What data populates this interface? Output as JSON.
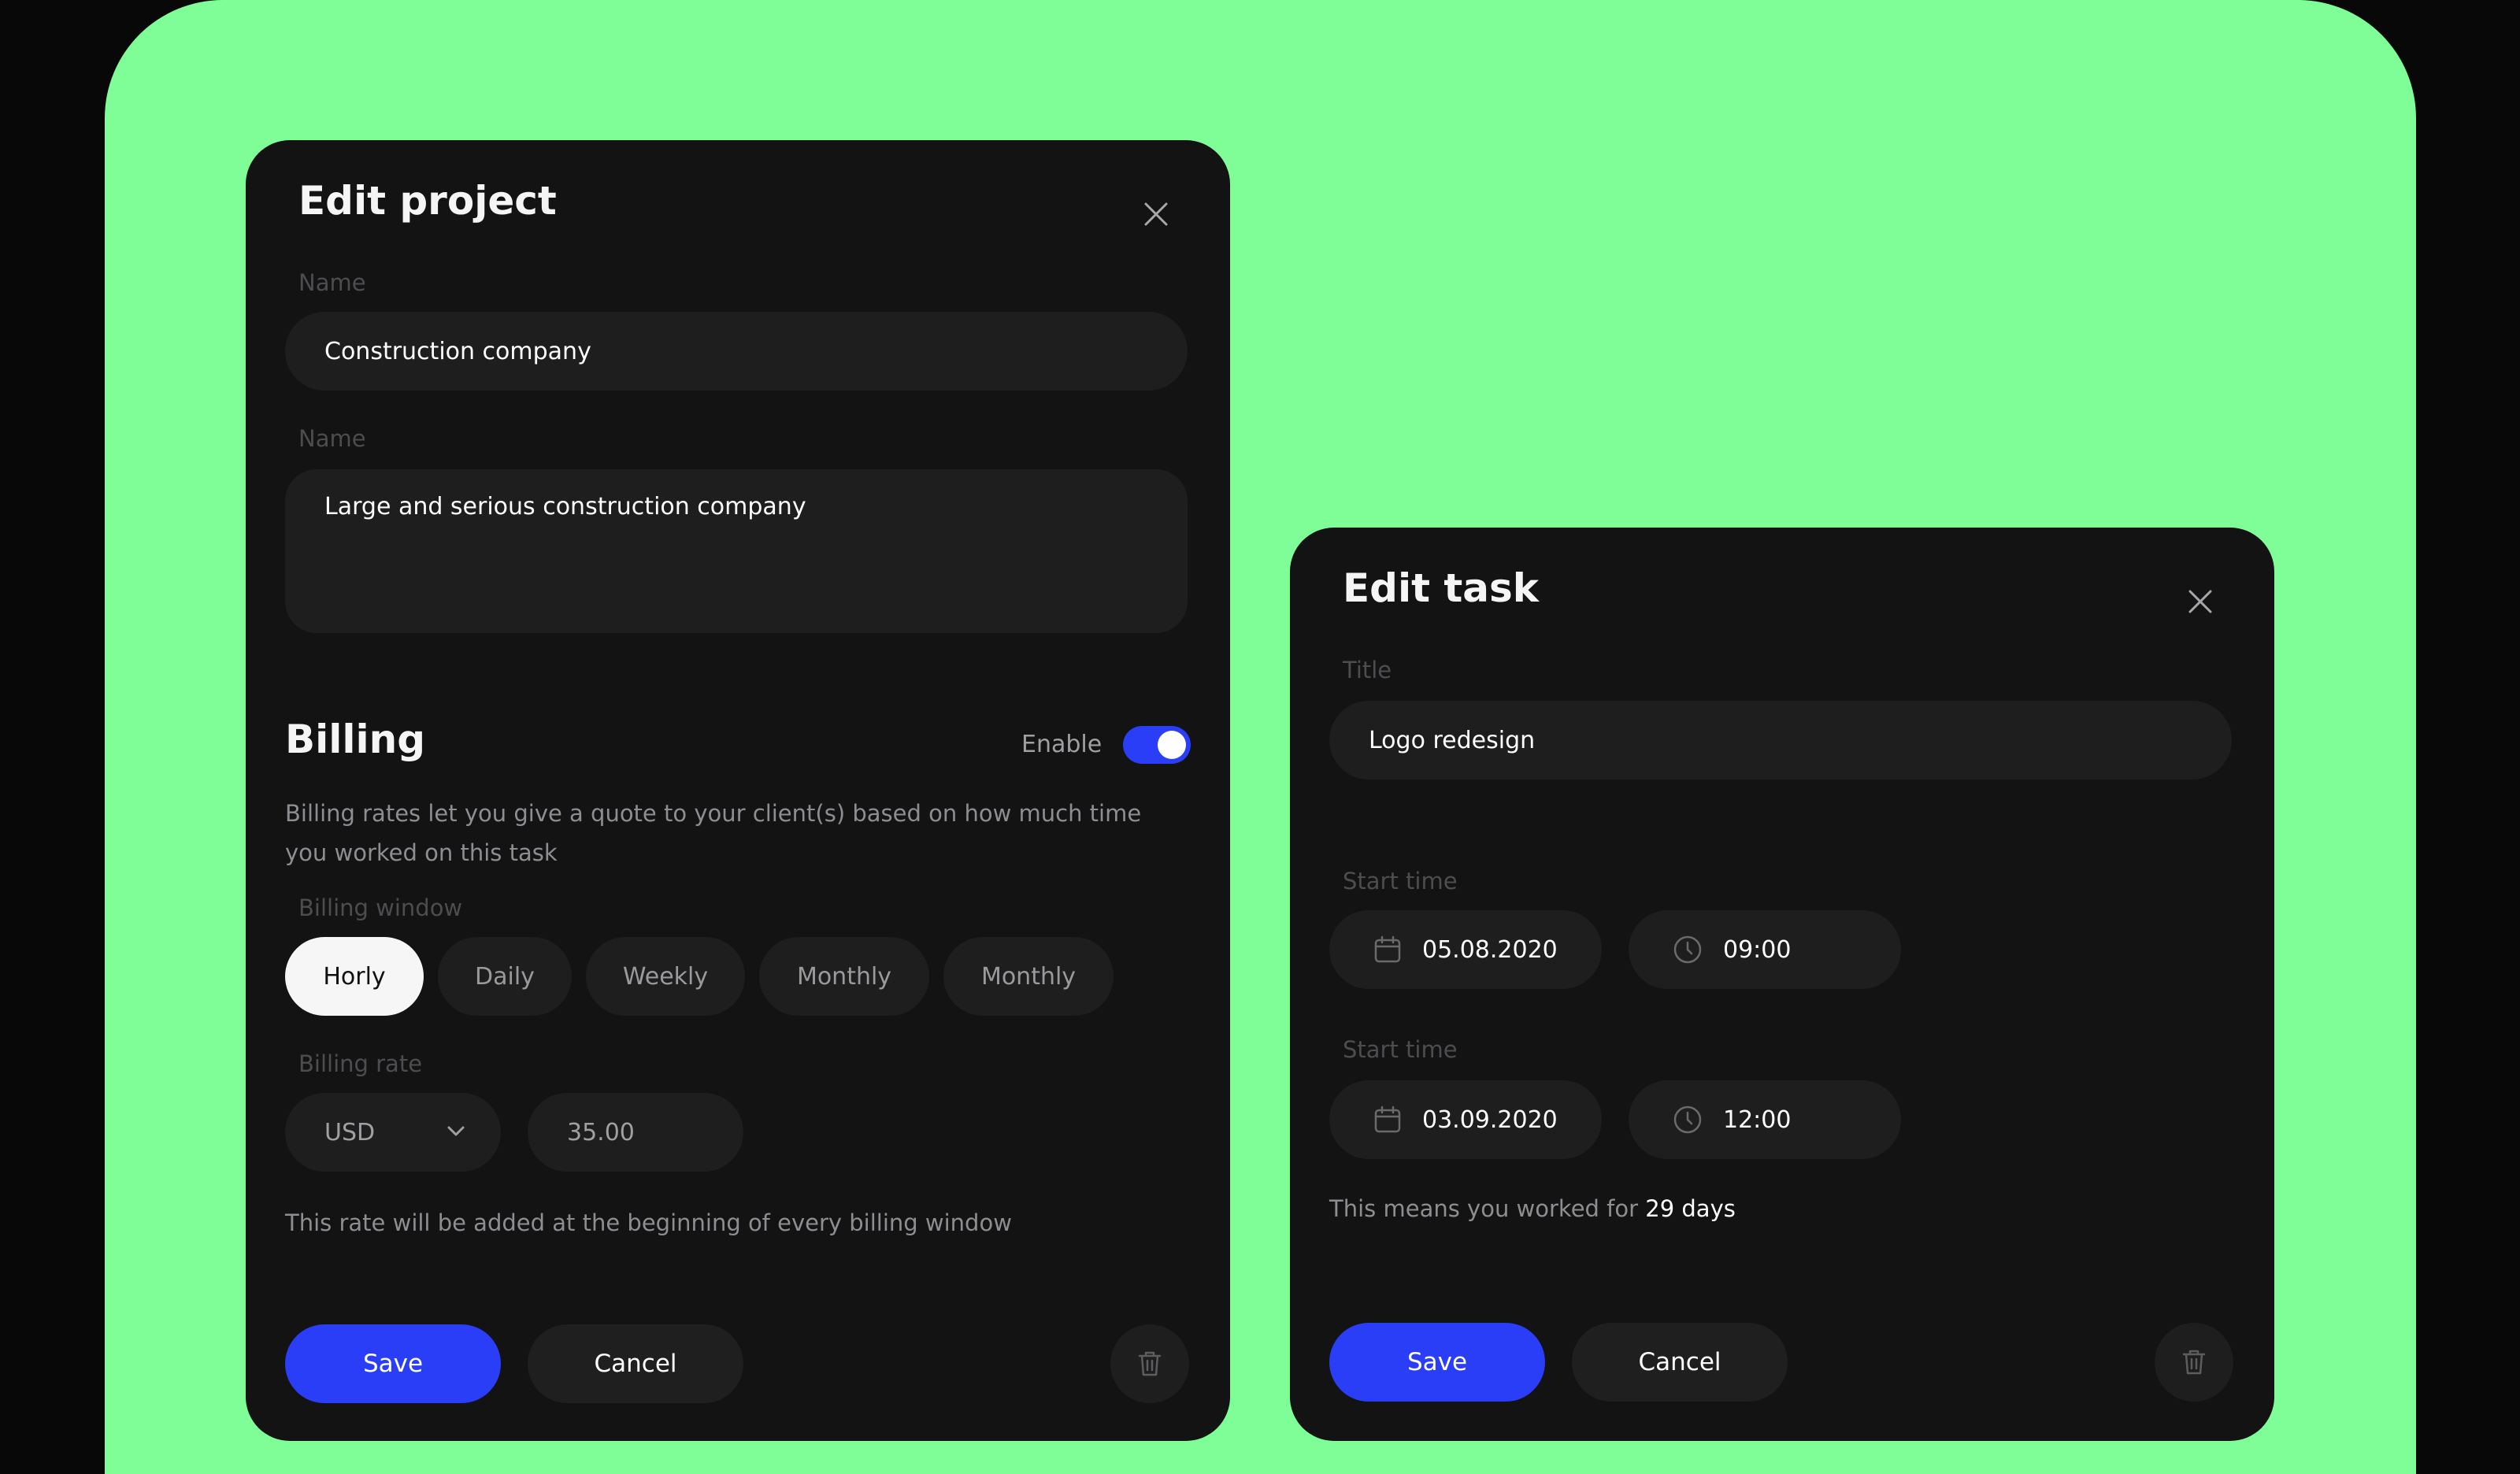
{
  "colors": {
    "background": "#7ffe98",
    "modal": "#131314",
    "field": "#1e1e1f",
    "accent": "#2a3ef8"
  },
  "project_modal": {
    "title": "Edit project",
    "close_icon": "close-icon",
    "name_label": "Name",
    "name_value": "Construction company",
    "description_label": "Name",
    "description_value": "Large and serious construction company",
    "billing": {
      "title": "Billing",
      "enable_label": "Enable",
      "enabled": true,
      "description": "Billing rates let you give a quote to your client(s) based on how much time you worked on this task",
      "window_label": "Billing window",
      "window_options": [
        "Horly",
        "Daily",
        "Weekly",
        "Monthly",
        "Monthly"
      ],
      "selected_window": "Horly",
      "rate_label": "Billing rate",
      "currency": "USD",
      "rate_value": "35.00",
      "note": "This rate will be added at the beginning of every billing window"
    },
    "save_label": "Save",
    "cancel_label": "Cancel",
    "delete_icon": "trash-icon"
  },
  "task_modal": {
    "title": "Edit task",
    "close_icon": "close-icon",
    "title_label": "Title",
    "title_value": "Logo redesign",
    "start_label": "Start time",
    "start_date": "05.08.2020",
    "start_time": "09:00",
    "end_label": "Start time",
    "end_date": "03.09.2020",
    "end_time": "12:00",
    "worked_prefix": "This means you worked for ",
    "worked_value": "29 days",
    "save_label": "Save",
    "cancel_label": "Cancel",
    "delete_icon": "trash-icon"
  }
}
